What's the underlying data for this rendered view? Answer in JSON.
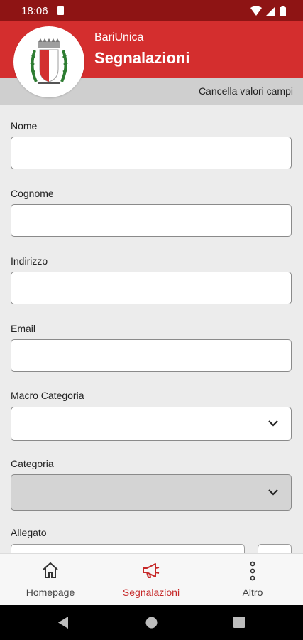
{
  "status_bar": {
    "time": "18:06"
  },
  "header": {
    "app_name": "BariUnica",
    "title": "Segnalazioni"
  },
  "toolbar": {
    "clear_label": "Cancella valori campi"
  },
  "form": {
    "nome_label": "Nome",
    "nome_value": "",
    "cognome_label": "Cognome",
    "cognome_value": "",
    "indirizzo_label": "Indirizzo",
    "indirizzo_value": "",
    "email_label": "Email",
    "email_value": "",
    "macro_label": "Macro Categoria",
    "macro_value": "",
    "categoria_label": "Categoria",
    "categoria_value": "",
    "allegato_label": "Allegato"
  },
  "bottom_nav": [
    {
      "label": "Homepage",
      "icon": "home-icon",
      "active": false
    },
    {
      "label": "Segnalazioni",
      "icon": "megaphone-icon",
      "active": true
    },
    {
      "label": "Altro",
      "icon": "more-vertical-icon",
      "active": false
    }
  ],
  "colors": {
    "header": "#d42e2e",
    "status_bar": "#8e1414",
    "accent": "#c62828",
    "subbar": "#cfcfcf",
    "background": "#ececec"
  }
}
